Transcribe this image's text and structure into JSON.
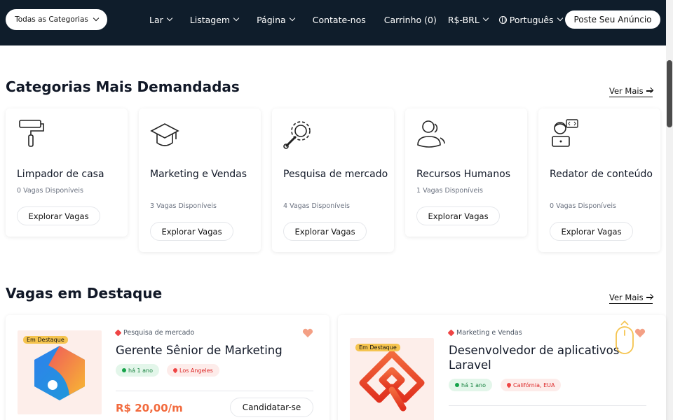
{
  "header": {
    "category_select": "Todas as Categorias",
    "nav": [
      {
        "label": "Lar",
        "dropdown": true
      },
      {
        "label": "Listagem",
        "dropdown": true
      },
      {
        "label": "Página",
        "dropdown": true
      },
      {
        "label": "Contate-nos",
        "dropdown": false
      },
      {
        "label": "Carrinho (0)",
        "dropdown": false
      }
    ],
    "currency": "R$-BRL",
    "language": "Português",
    "post_button": "Poste Seu Anúncio",
    "background_color": "#0f1d2b"
  },
  "categories_section": {
    "title": "Categorias Mais Demandadas",
    "see_more": "Ver Mais",
    "explore_label": "Explorar Vagas",
    "items": [
      {
        "name": "Limpador de casa",
        "count": "0 Vagas Disponíveis",
        "icon": "paint-roller-icon"
      },
      {
        "name": "Marketing e Vendas",
        "count": "3 Vagas Disponíveis",
        "icon": "graduation-cap-icon"
      },
      {
        "name": "Pesquisa de mercado",
        "count": "4 Vagas Disponíveis",
        "icon": "gear-wrench-icon"
      },
      {
        "name": "Recursos Humanos",
        "count": "1 Vagas Disponíveis",
        "icon": "users-icon"
      },
      {
        "name": "Redator de conteúdo",
        "count": "0 Vagas Disponíveis",
        "icon": "developer-icon"
      }
    ]
  },
  "featured_section": {
    "title": "Vagas em Destaque",
    "see_more": "Ver Mais",
    "badge": "Em Destaque",
    "jobs": [
      {
        "category": "Pesquisa de mercado",
        "title": "Gerente Sênior de Marketing",
        "time": "há 1 ano",
        "location": "Los Angeles",
        "salary": "R$ 20,00/m",
        "apply": "Candidatar-se"
      },
      {
        "category": "Marketing e Vendas",
        "title": "Desenvolvedor de aplicativos Laravel",
        "time": "há 1 ano",
        "location": "Califórnia, EUA"
      }
    ]
  },
  "colors": {
    "accent": "#f26a3d",
    "heart": "#f4a085",
    "badge": "#f5c44f"
  }
}
